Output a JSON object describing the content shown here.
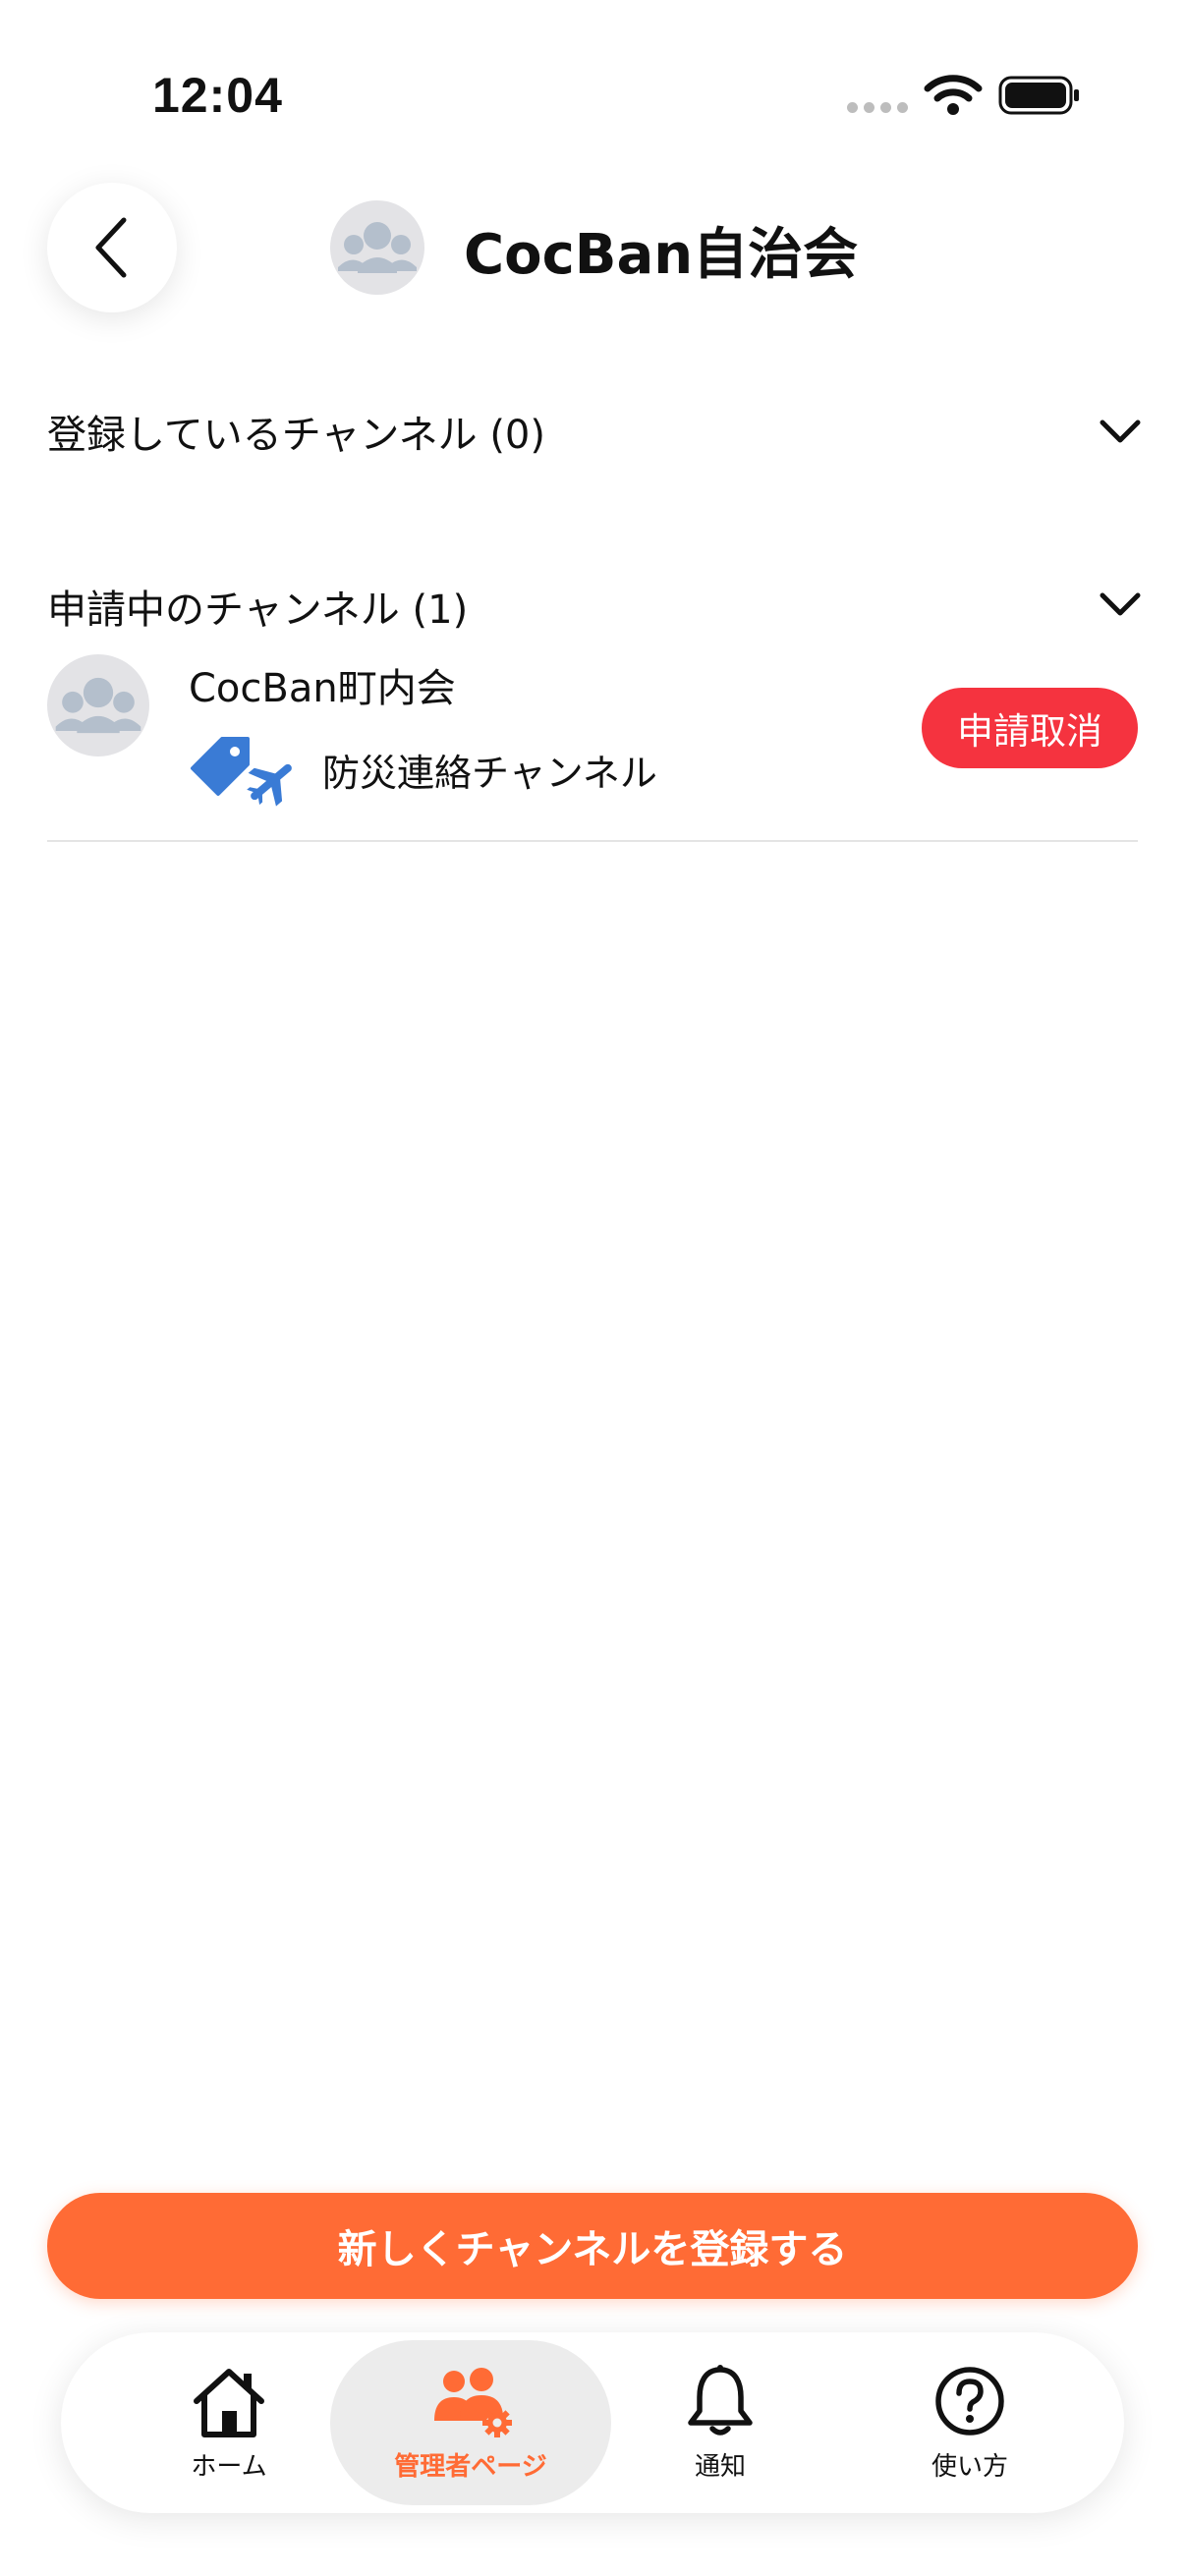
{
  "status_bar": {
    "time": "12:04"
  },
  "header": {
    "title": "CocBan自治会"
  },
  "sections": {
    "registered": {
      "title": "登録しているチャンネル (0)"
    },
    "pending": {
      "title": "申請中のチャンネル (1)",
      "items": [
        {
          "name": "CocBan町内会",
          "channel": "防災連絡チャンネル",
          "action": "申請取消"
        }
      ]
    }
  },
  "register_button": {
    "label": "新しくチャンネルを登録する"
  },
  "tab_bar": {
    "tabs": [
      {
        "label": "ホーム",
        "icon": "home-icon"
      },
      {
        "label": "管理者ページ",
        "icon": "admin-icon",
        "active": true
      },
      {
        "label": "通知",
        "icon": "bell-icon"
      },
      {
        "label": "使い方",
        "icon": "help-icon"
      }
    ]
  },
  "colors": {
    "accent": "#ff6b35",
    "danger": "#f5333f",
    "channel_icon": "#3a7bd5",
    "avatar_fill": "#b4bfcc"
  }
}
